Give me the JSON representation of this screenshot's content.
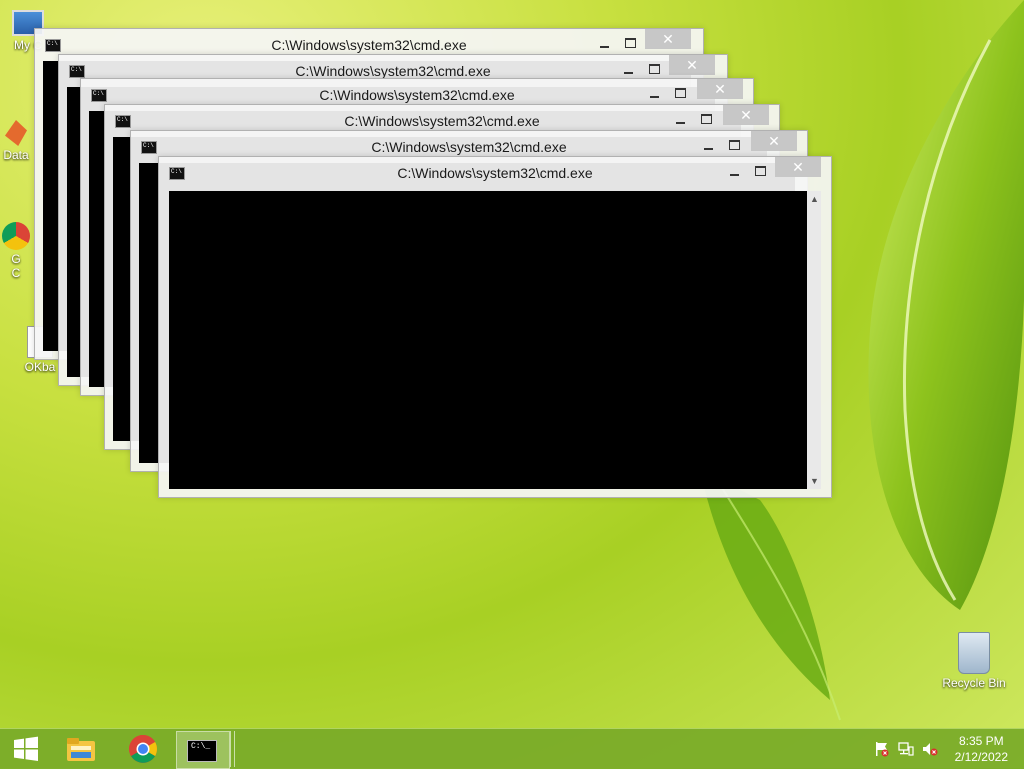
{
  "desktop": {
    "icons": [
      {
        "label": "My C",
        "icon": "computer-icon"
      },
      {
        "label": "Data",
        "icon": "app-shortcut-icon"
      },
      {
        "label": "G\nC",
        "icon": "chrome-icon"
      },
      {
        "label": "OKba",
        "icon": "document-icon"
      },
      {
        "label": "Recycle Bin",
        "icon": "recycle-bin-icon"
      }
    ]
  },
  "windows": [
    {
      "title": "C:\\Windows\\system32\\cmd.exe",
      "close_glyph": "✕"
    },
    {
      "title": "C:\\Windows\\system32\\cmd.exe",
      "close_glyph": "✕"
    },
    {
      "title": "C:\\Windows\\system32\\cmd.exe",
      "close_glyph": "✕"
    },
    {
      "title": "C:\\Windows\\system32\\cmd.exe",
      "close_glyph": "✕"
    },
    {
      "title": "C:\\Windows\\system32\\cmd.exe",
      "close_glyph": "✕"
    },
    {
      "title": "C:\\Windows\\system32\\cmd.exe",
      "close_glyph": "✕"
    }
  ],
  "taskbar": {
    "start_icon": "windows-logo-icon",
    "pinned": [
      {
        "icon": "file-explorer-icon"
      },
      {
        "icon": "chrome-icon"
      },
      {
        "icon": "cmd-icon",
        "active": true
      }
    ],
    "tray": [
      {
        "icon": "action-center-flag-icon"
      },
      {
        "icon": "network-icon"
      },
      {
        "icon": "volume-muted-icon"
      }
    ],
    "clock": {
      "time": "8:35 PM",
      "date": "2/12/2022"
    }
  },
  "colors": {
    "taskbar": "#78aa28",
    "console": "#000000",
    "close_button": "#c7c7c7"
  }
}
